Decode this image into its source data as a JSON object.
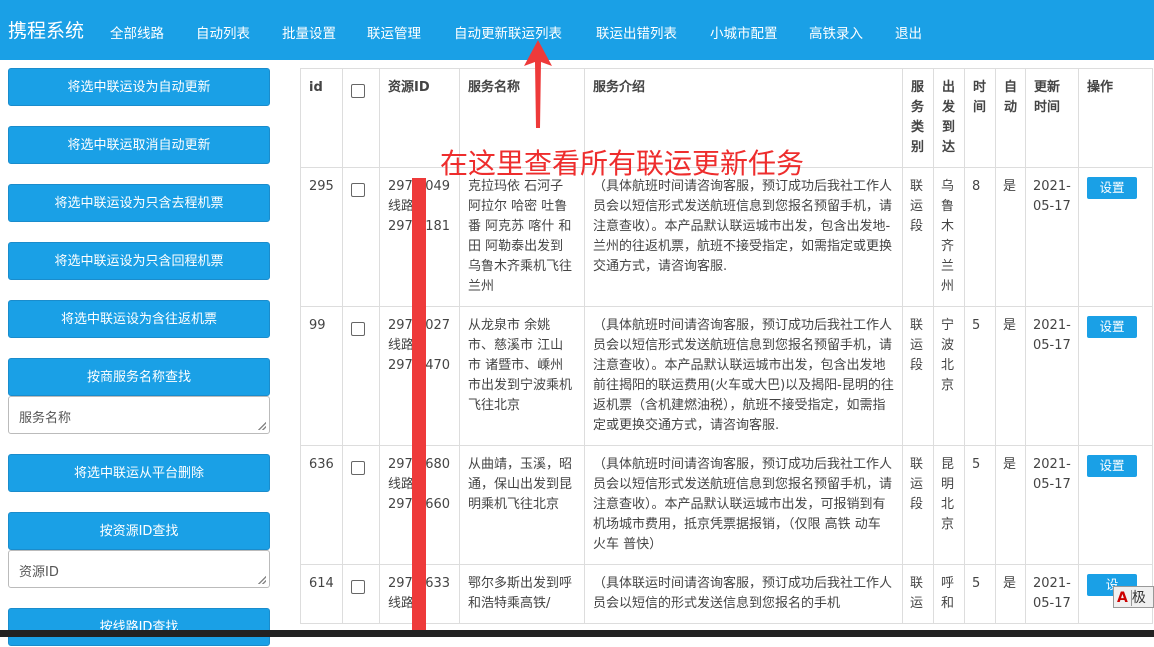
{
  "nav": {
    "brand": "携程系统",
    "items": [
      "全部线路",
      "自动列表",
      "批量设置",
      "联运管理",
      "自动更新联运列表",
      "联运出错列表",
      "小城市配置",
      "高铁录入",
      "退出"
    ]
  },
  "sidebar": {
    "btn_auto_update": "将选中联运设为自动更新",
    "btn_cancel_auto": "将选中联运取消自动更新",
    "btn_outbound_only": "将选中联运设为只含去程机票",
    "btn_return_only": "将选中联运设为只含回程机票",
    "btn_round_trip": "将选中联运设为含往返机票",
    "btn_search_service": "按商服务名称查找",
    "service_name_placeholder": "服务名称",
    "btn_delete": "将选中联运从平台删除",
    "btn_search_resource": "按资源ID查找",
    "resource_id_placeholder": "资源ID",
    "btn_search_route": "按线路ID查找"
  },
  "table": {
    "headers": {
      "id": "id",
      "resource_id": "资源ID",
      "service_name": "服务名称",
      "service_desc": "服务介绍",
      "service_type": "服务类别",
      "depart_arrive": "出发到达",
      "time": "时间",
      "auto": "自动",
      "update_time": "更新时间",
      "action": "操作"
    },
    "rows": [
      {
        "id": "295",
        "resource_id": "2976 049 线路 2974 181",
        "service_name": "克拉玛依 石河子 阿拉尔 哈密 吐鲁番 阿克苏 喀什 和田 阿勒泰出发到乌鲁木齐乘机飞往兰州",
        "service_desc": "（具体航班时间请咨询客服，预订成功后我社工作人员会以短信形式发送航班信息到您报名预留手机，请注意查收）。本产品默认联运城市出发，包含出发地-兰州的往返机票，航班不接受指定，如需指定或更换交通方式，请咨询客服.",
        "service_type": "联运段",
        "depart_arrive": "乌鲁木齐兰州",
        "time": "8",
        "auto": "是",
        "update_time": "2021-05-17",
        "action": "设置"
      },
      {
        "id": "99",
        "resource_id": "2976 027 线路 2974 470",
        "service_name": "从龙泉市 余姚市、慈溪市 江山市 诸暨市、嵊州市出发到宁波乘机飞往北京",
        "service_desc": "（具体航班时间请咨询客服，预订成功后我社工作人员会以短信形式发送航班信息到您报名预留手机，请注意查收）。本产品默认联运城市出发，包含出发地前往揭阳的联运费用(火车或大巴)以及揭阳-昆明的往返机票（含机建燃油税），航班不接受指定，如需指定或更换交通方式，请咨询客服.",
        "service_type": "联运段",
        "depart_arrive": "宁波北京",
        "time": "5",
        "auto": "是",
        "update_time": "2021-05-17",
        "action": "设置"
      },
      {
        "id": "636",
        "resource_id": "2979 680 线路 2979 660",
        "service_name": "从曲靖，玉溪，昭通，保山出发到昆明乘机飞往北京",
        "service_desc": "（具体航班时间请咨询客服，预订成功后我社工作人员会以短信形式发送航班信息到您报名预留手机，请注意查收）。本产品默认联运城市出发，可报销到有机场城市费用，抵京凭票据报销，（仅限 高铁 动车 火车 普快）",
        "service_type": "联运段",
        "depart_arrive": "昆明北京",
        "time": "5",
        "auto": "是",
        "update_time": "2021-05-17",
        "action": "设置"
      },
      {
        "id": "614",
        "resource_id": "2979 633 线路",
        "service_name": "鄂尔多斯出发到呼和浩特乘高铁/",
        "service_desc": "（具体联运时间请咨询客服，预订成功后我社工作人员会以短信的形式发送信息到您报名的手机",
        "service_type": "联运",
        "depart_arrive": "呼和",
        "time": "5",
        "auto": "是",
        "update_time": "2021-05-17",
        "action": "设"
      }
    ]
  },
  "annotation": {
    "text": "在这里查看所有联运更新任务"
  },
  "corner_badge": {
    "a": "A",
    "b": "极"
  },
  "colors": {
    "nav_bg": "#1aa0e6",
    "accent": "#1aa0e6",
    "annotation": "#ee2d2d"
  }
}
